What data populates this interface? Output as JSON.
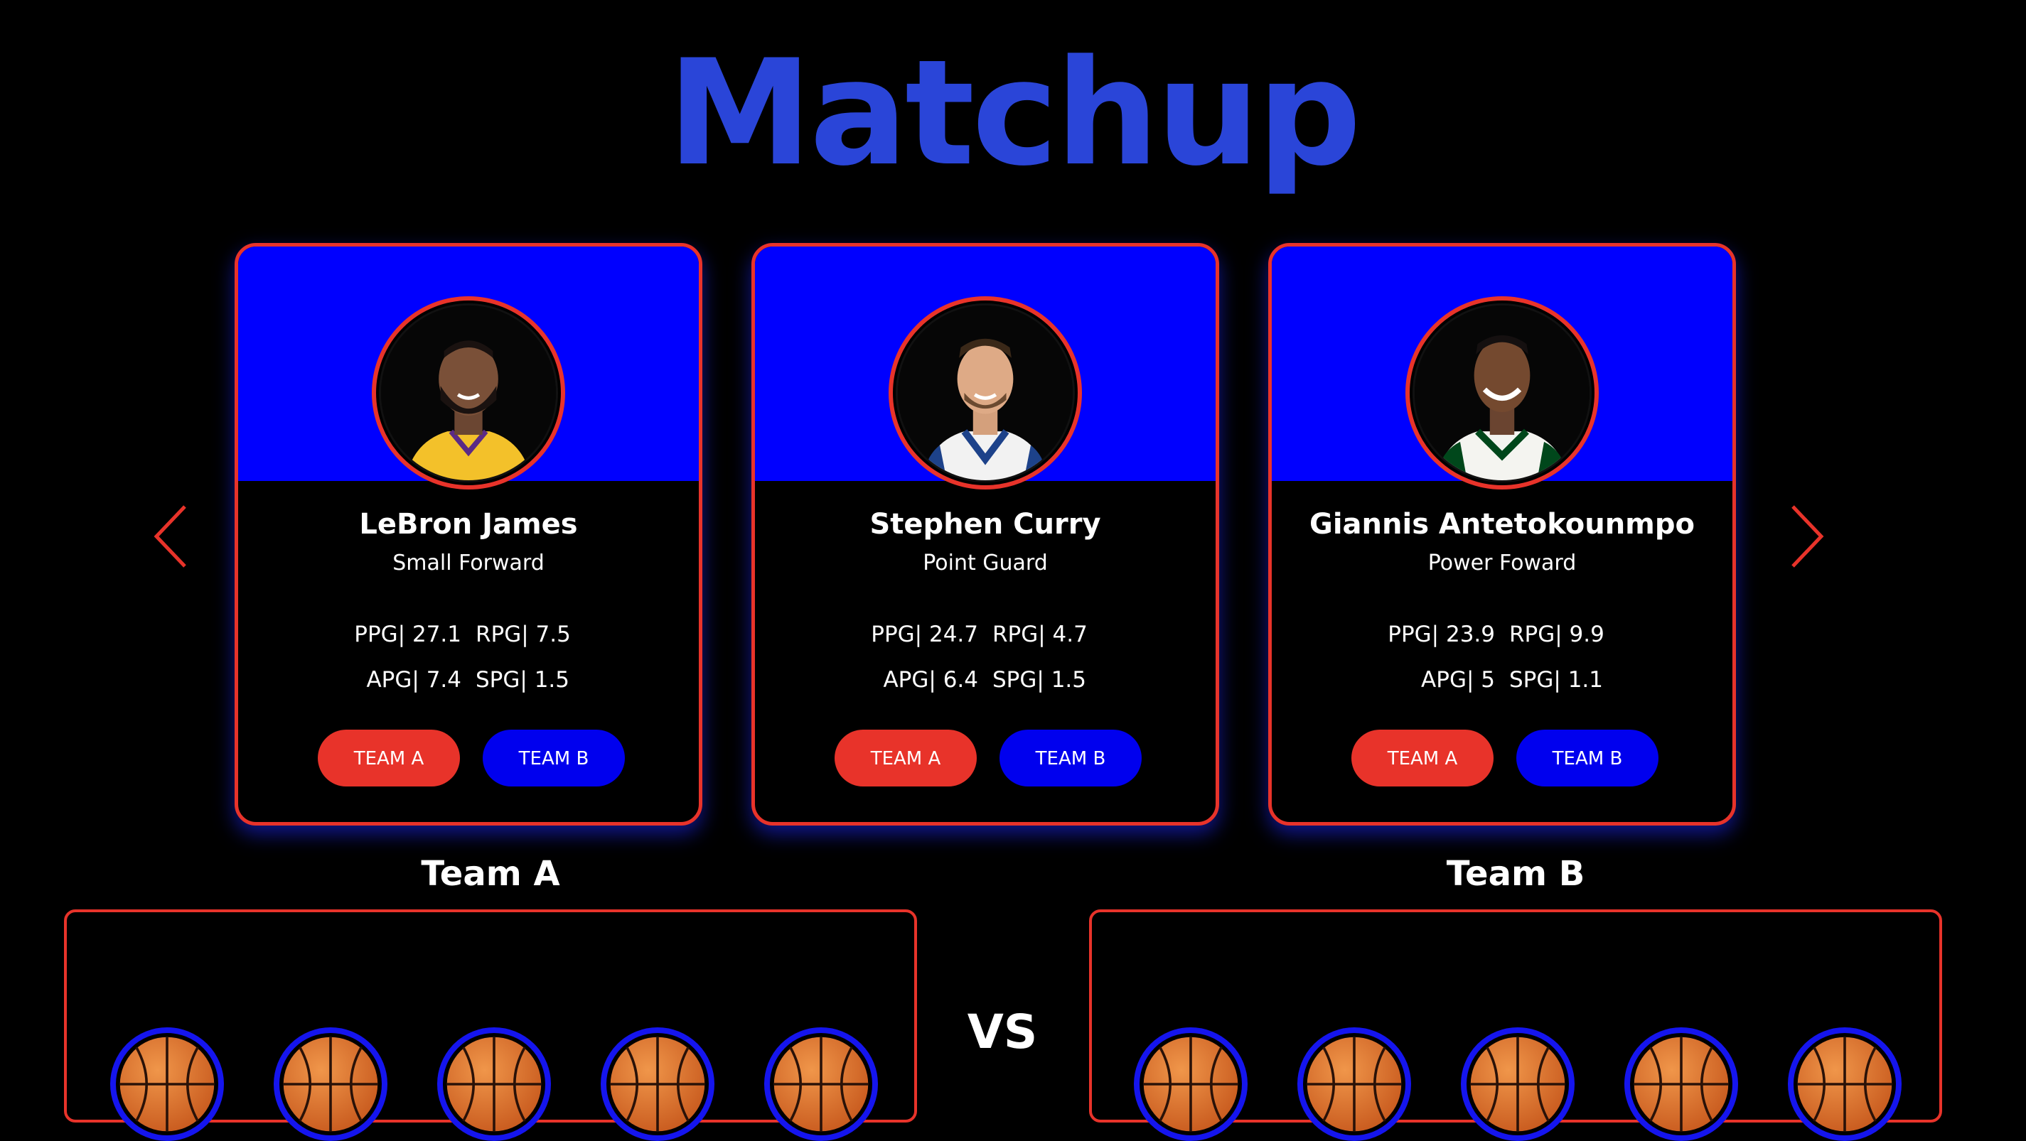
{
  "title": "Matchup",
  "navigation": {
    "prev_icon": "chevron-left-icon",
    "next_icon": "chevron-right-icon",
    "accent_color": "#e8332a"
  },
  "players": [
    {
      "name": "LeBron James",
      "position": "Small Forward",
      "stats": {
        "ppg": "PPG| 27.1",
        "rpg": "RPG| 7.5",
        "apg": "APG| 7.4",
        "spg": "SPG| 1.5"
      },
      "team_a_label": "TEAM A",
      "team_b_label": "TEAM B",
      "jersey_color": "#f3c12a"
    },
    {
      "name": "Stephen Curry",
      "position": "Point Guard",
      "stats": {
        "ppg": "PPG| 24.7",
        "rpg": "RPG| 4.7",
        "apg": "APG| 6.4",
        "spg": "SPG| 1.5"
      },
      "team_a_label": "TEAM A",
      "team_b_label": "TEAM B",
      "jersey_color": "#f2f2f2"
    },
    {
      "name": "Giannis Antetokounmpo",
      "position": "Power Foward",
      "stats": {
        "ppg": "PPG| 23.9",
        "rpg": "RPG| 9.9",
        "apg": "APG| 5",
        "spg": "SPG| 1.1"
      },
      "team_a_label": "TEAM A",
      "team_b_label": "TEAM B",
      "jersey_color": "#f4f4f0"
    }
  ],
  "teams": {
    "team_a": {
      "heading": "Team A",
      "slots": 5
    },
    "team_b": {
      "heading": "Team B",
      "slots": 5
    },
    "vs_label": "VS"
  },
  "colors": {
    "brand_blue": "#2a45d8",
    "card_blue": "#0000ff",
    "team_a_button": "#e8332a",
    "team_b_button": "#0000ee",
    "border_red": "#e8332a"
  }
}
